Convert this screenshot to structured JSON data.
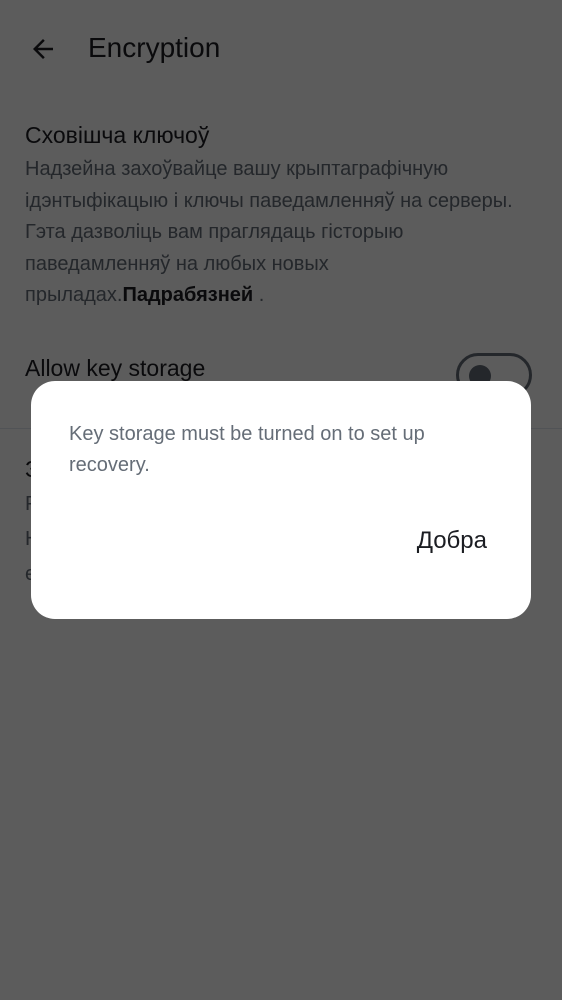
{
  "header": {
    "title": "Encryption",
    "back_icon": "arrow-left-icon"
  },
  "key_storage": {
    "title": "Сховішча ключоў",
    "description": "Надзейна захоўвайце вашу крыптаграфічную ідэнтыфікацыю і ключы паведамленняў на серверы. Гэта дазволіць вам праглядаць гісторыю паведамленняў на любых новых прыладах.",
    "link": "Падрабязней",
    "link_suffix": " .",
    "toggle_label": "Allow key storage",
    "toggle_on": false
  },
  "recovery_partial": [
    "З",
    "Р",
    "Н",
    "е"
  ],
  "dialog": {
    "message": "Key storage must be turned on to set up recovery.",
    "ok_label": "Добра"
  }
}
